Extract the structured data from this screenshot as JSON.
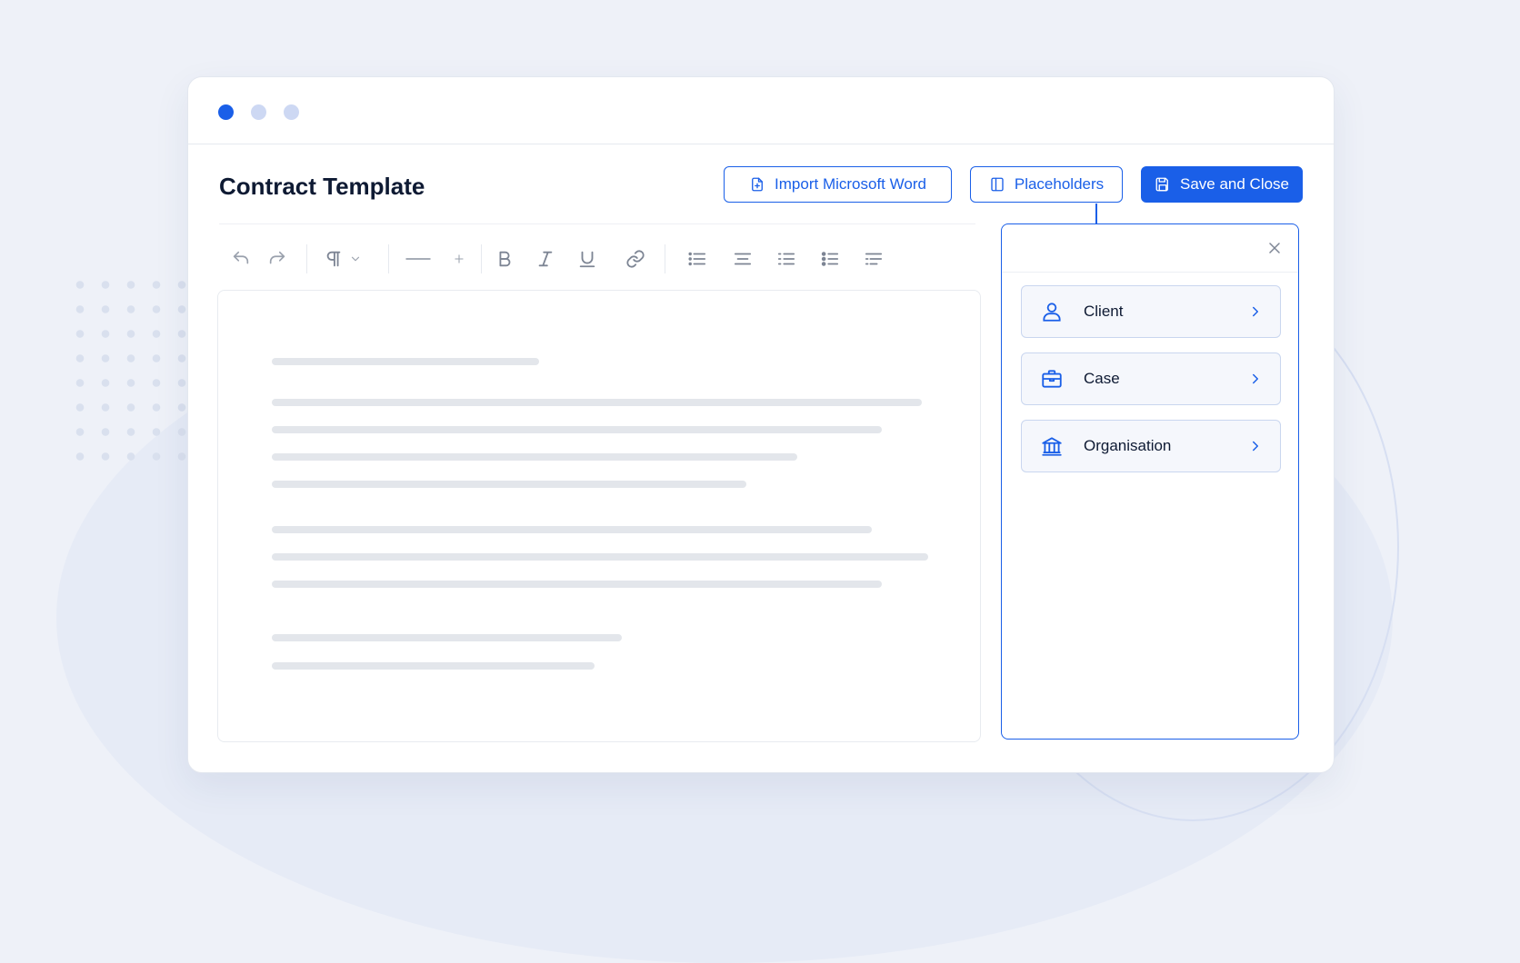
{
  "window": {
    "title": "Contract Template"
  },
  "header": {
    "import_label": "Import Microsoft Word",
    "placeholders_label": "Placeholders",
    "save_label": "Save and Close"
  },
  "toolbar": {
    "icons": [
      "undo-icon",
      "redo-icon",
      "paragraph-icon",
      "chevron-down-icon",
      "horizontal-rule-icon",
      "plus-icon",
      "bold-icon",
      "italic-icon",
      "underline-icon",
      "link-icon",
      "list-icon",
      "align-icon",
      "bullet-list-icon",
      "ordered-list-icon",
      "checklist-icon"
    ]
  },
  "placeholders_panel": {
    "items": [
      {
        "label": "Client",
        "icon": "person-icon"
      },
      {
        "label": "Case",
        "icon": "briefcase-icon"
      },
      {
        "label": "Organisation",
        "icon": "bank-icon"
      }
    ]
  },
  "colors": {
    "accent": "#1a5fe8",
    "title_text": "#0e1a33",
    "placeholder_line": "#e3e6eb"
  }
}
